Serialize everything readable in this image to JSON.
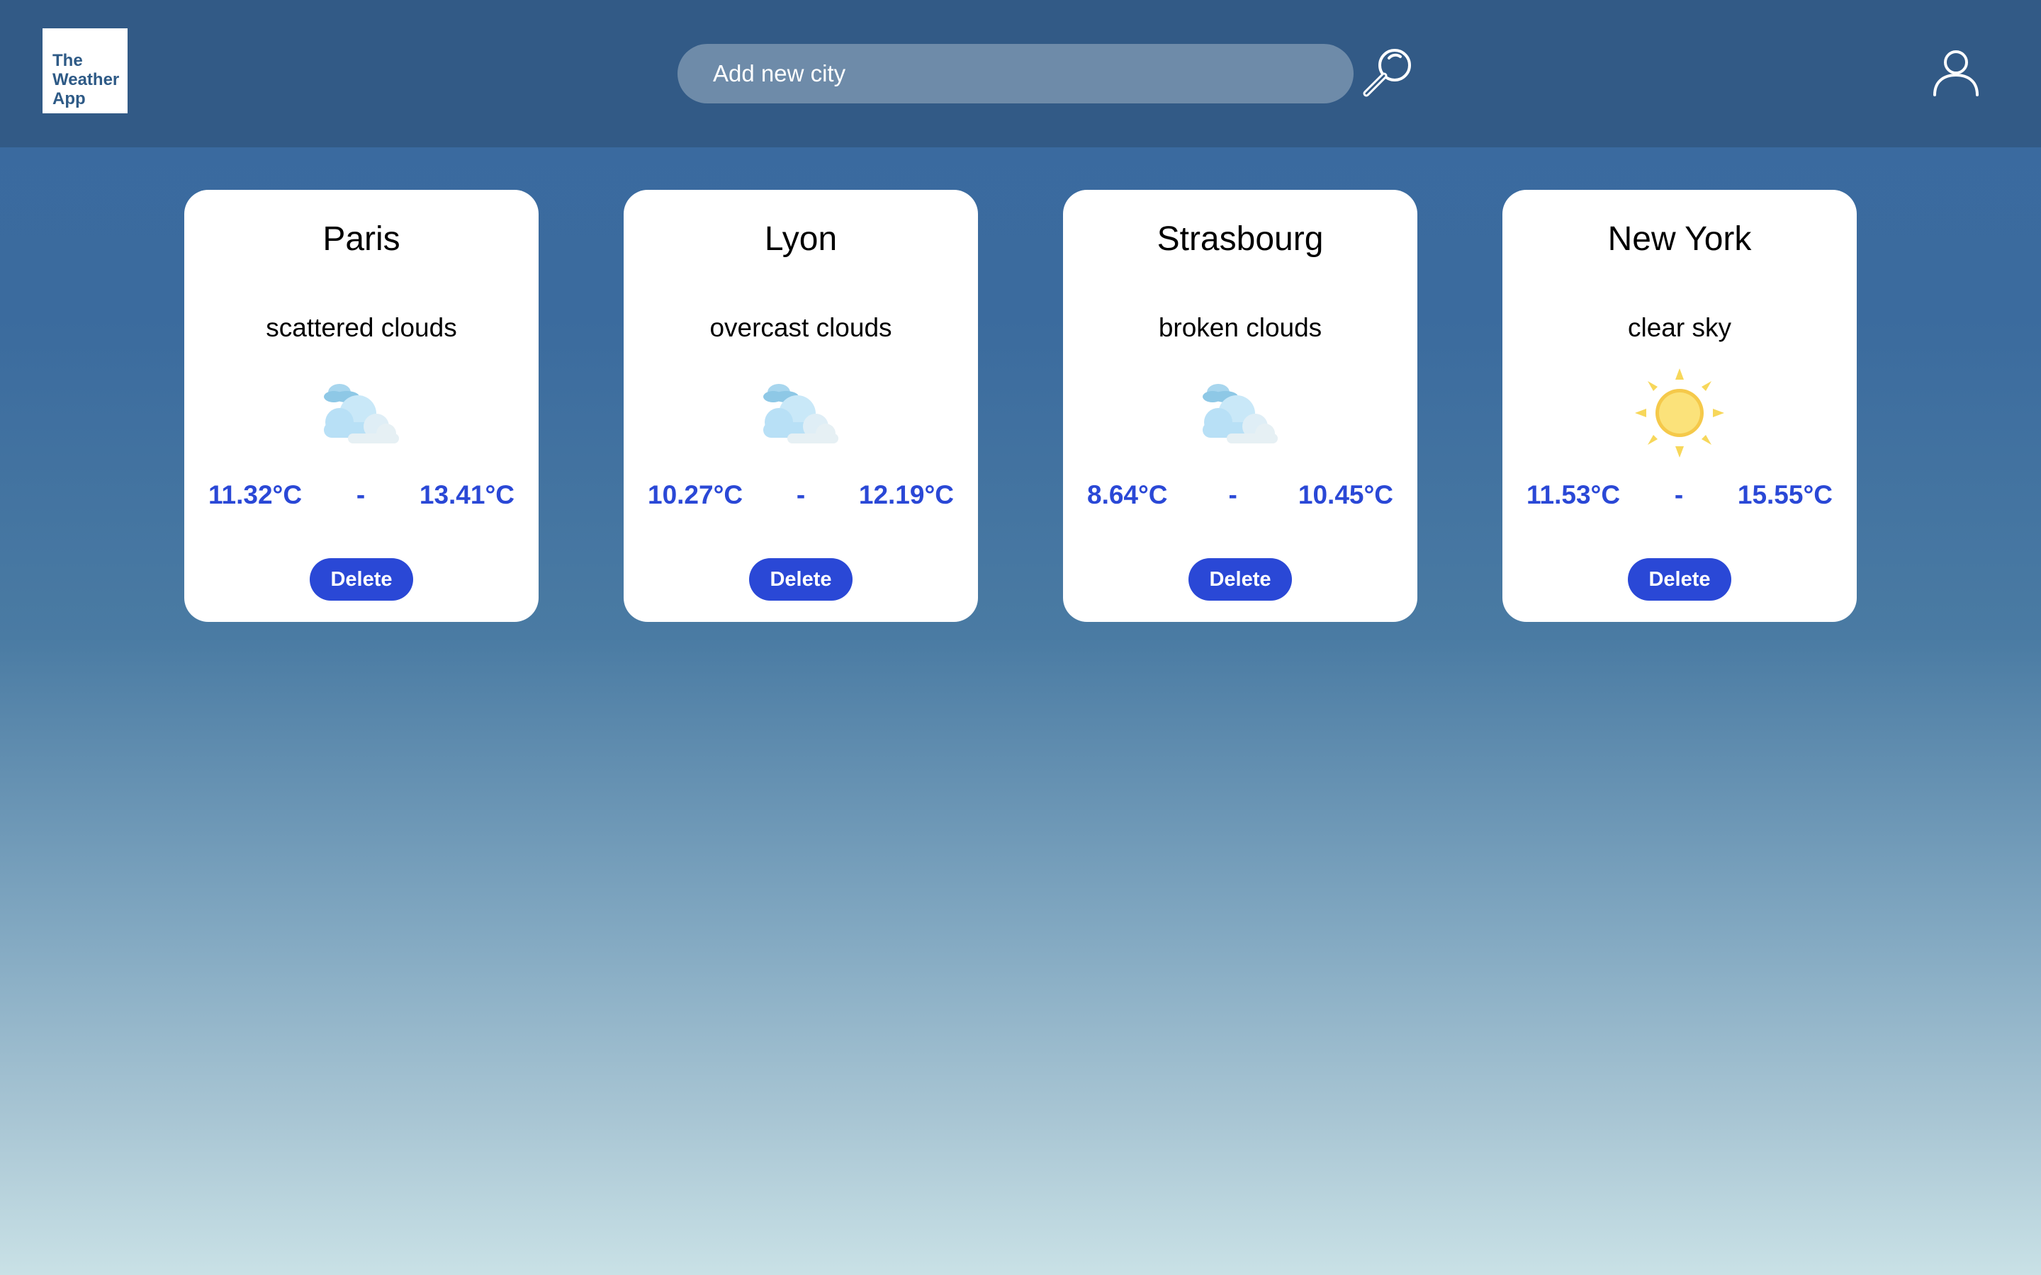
{
  "app": {
    "logo_line1": "The",
    "logo_line2": "Weather",
    "logo_line3": "App"
  },
  "search": {
    "placeholder": "Add new city",
    "value": ""
  },
  "icons": {
    "search": "magnifier-icon",
    "user": "user-icon",
    "clouds": "clouds-icon",
    "sun": "sun-icon"
  },
  "colors": {
    "header": "#325a86",
    "accent": "#2a48d6",
    "card": "#ffffff"
  },
  "cities": [
    {
      "name": "Paris",
      "description": "scattered clouds",
      "icon": "clouds-icon",
      "min": "11.32°C",
      "separator": "-",
      "max": "13.41°C",
      "delete_label": "Delete"
    },
    {
      "name": "Lyon",
      "description": "overcast clouds",
      "icon": "clouds-icon",
      "min": "10.27°C",
      "separator": "-",
      "max": "12.19°C",
      "delete_label": "Delete"
    },
    {
      "name": "Strasbourg",
      "description": "broken clouds",
      "icon": "clouds-icon",
      "min": "8.64°C",
      "separator": "-",
      "max": "10.45°C",
      "delete_label": "Delete"
    },
    {
      "name": "New York",
      "description": "clear sky",
      "icon": "sun-icon",
      "min": "11.53°C",
      "separator": "-",
      "max": "15.55°C",
      "delete_label": "Delete"
    }
  ]
}
